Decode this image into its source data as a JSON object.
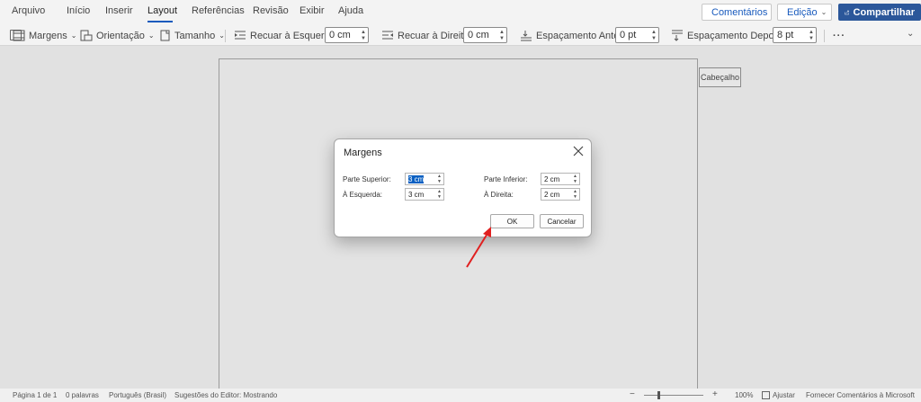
{
  "tabs": [
    {
      "label": "Arquivo"
    },
    {
      "label": "Início"
    },
    {
      "label": "Inserir"
    },
    {
      "label": "Layout"
    },
    {
      "label": "Referências"
    },
    {
      "label": "Revisão"
    },
    {
      "label": "Exibir"
    },
    {
      "label": "Ajuda"
    }
  ],
  "active_tab": "Layout",
  "header_buttons": {
    "comments": "Comentários",
    "edit": "Edição",
    "share": "Compartilhar"
  },
  "ribbon": {
    "margins": "Margens",
    "orientation": "Orientação",
    "size": "Tamanho",
    "indent_left_label": "Recuar à Esquerda",
    "indent_left_value": "0 cm",
    "indent_right_label": "Recuar à Direita",
    "indent_right_value": "0 cm",
    "spacing_before_label": "Espaçamento Antes",
    "spacing_before_value": "0 pt",
    "spacing_after_label": "Espaçamento Depois",
    "spacing_after_value": "8 pt",
    "more": "···"
  },
  "document": {
    "header_tag": "Cabeçalho"
  },
  "dialog": {
    "title": "Margens",
    "top_label": "Parte Superior:",
    "top_value": "3 cm",
    "bottom_label": "Parte Inferior:",
    "bottom_value": "2 cm",
    "left_label": "À Esquerda:",
    "left_value": "3 cm",
    "right_label": "À Direita:",
    "right_value": "2 cm",
    "ok": "OK",
    "cancel": "Cancelar"
  },
  "status": {
    "page": "Página 1 de 1",
    "words": "0 palavras",
    "language": "Português (Brasil)",
    "editor": "Sugestões do Editor: Mostrando",
    "zoom": "100%",
    "fit": "Ajustar",
    "feedback": "Fornecer Comentários à Microsoft"
  },
  "colors": {
    "accent": "#185abd",
    "share": "#2b579a",
    "annotation_arrow": "#e02020"
  }
}
